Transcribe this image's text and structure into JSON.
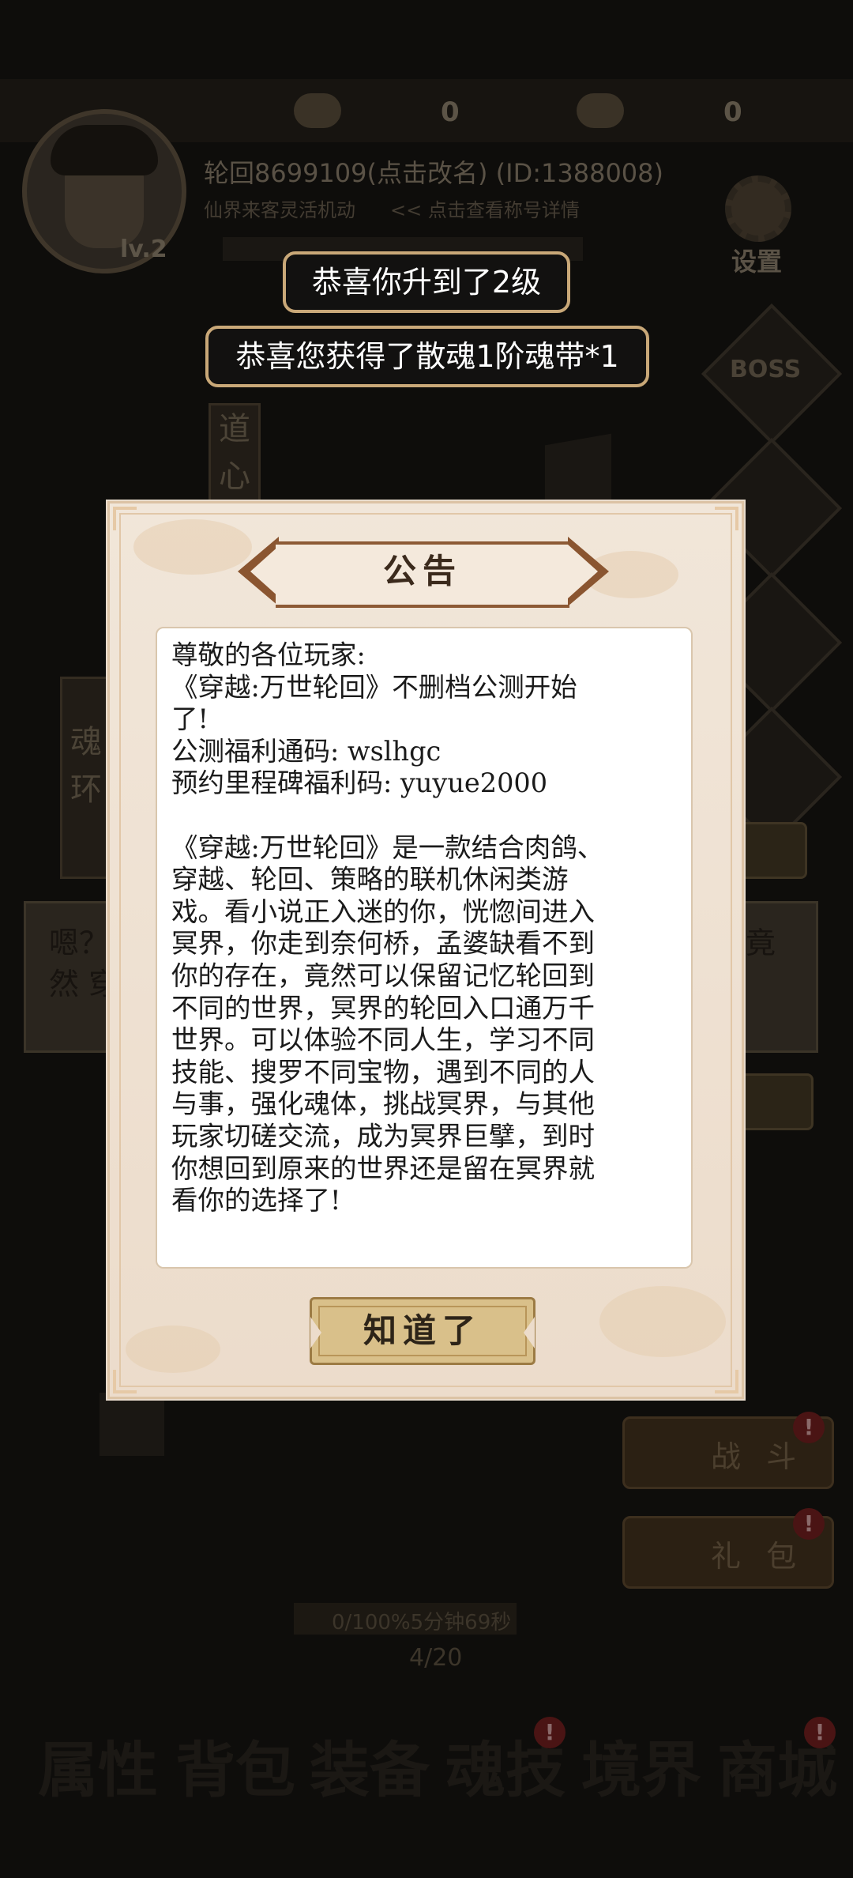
{
  "resources": {
    "item1_value": "0",
    "item2_value": "0"
  },
  "player": {
    "name": "轮回8699109(点击改名) (ID:1388008)",
    "level": "lv.2",
    "sub_left": "仙界来客灵活机动",
    "sub_right": "<< 点击查看称号详情"
  },
  "settings_label": "设置",
  "side_labels": {
    "boss": "BOSS"
  },
  "left_scroll_1": [
    "道",
    "心"
  ],
  "left_scroll_2": [
    "魂",
    "环"
  ],
  "story_dialog": {
    "line1": "嗯？",
    "line2": "然 穿",
    "tail": "竟"
  },
  "side_buttons": {
    "battle": "战 斗",
    "gift": "礼 包"
  },
  "progress": {
    "text": "0/100%5分钟69秒",
    "count": "4/20"
  },
  "bottom_tabs": [
    "属性",
    "背包",
    "装备",
    "魂技",
    "境界",
    "商城"
  ],
  "toasts": {
    "level_up": "恭喜你升到了2级",
    "reward": "恭喜您获得了散魂1阶魂带*1"
  },
  "notice": {
    "title": "公告",
    "lines": [
      "尊敬的各位玩家:",
      "《穿越:万世轮回》不删档公测开始",
      "了!",
      "公测福利通码: wslhgc",
      "预约里程碑福利码: yuyue2000",
      "",
      "《穿越:万世轮回》是一款结合肉鸽、",
      "穿越、轮回、策略的联机休闲类游",
      "戏。看小说正入迷的你，恍惚间进入",
      "冥界，你走到奈何桥，孟婆缺看不到",
      "你的存在，竟然可以保留记忆轮回到",
      "不同的世界，冥界的轮回入口通万千",
      "世界。可以体验不同人生，学习不同",
      "技能、搜罗不同宝物，遇到不同的人",
      "与事，强化魂体，挑战冥界，与其他",
      "玩家切磋交流，成为冥界巨擘，到时",
      "你想回到原来的世界还是留在冥界就",
      "看你的选择了!"
    ],
    "ok_label": "知道了"
  },
  "colors": {
    "toast_border": "#c9a878",
    "modal_bg": "#ecdccb",
    "title_frame": "#8a5530"
  }
}
